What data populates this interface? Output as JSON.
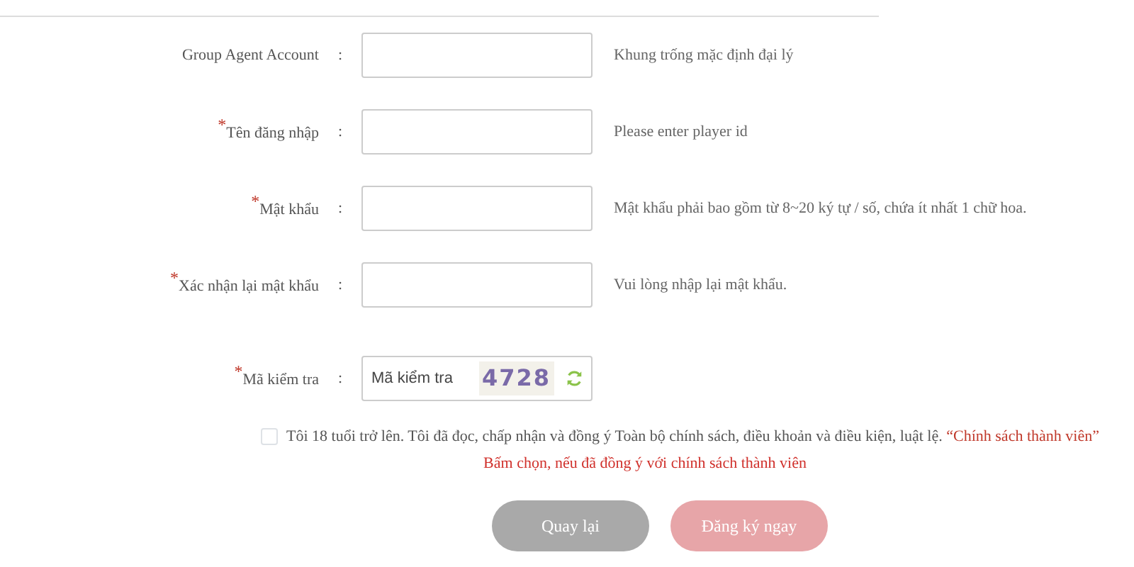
{
  "fields": [
    {
      "label": "Group Agent Account",
      "separator": ":",
      "hint": "Khung trống mặc định đại lý"
    },
    {
      "mark": "*",
      "label": "Tên đăng nhập",
      "separator": ":",
      "hint": "Please enter player id"
    },
    {
      "mark": "*",
      "label": "Mật khẩu",
      "separator": ":",
      "hint": "Mật khẩu phải bao gồm từ 8~20 ký tự / số, chứa ít nhất 1 chữ hoa."
    },
    {
      "mark": "*",
      "label": "Xác nhận lại mật khẩu",
      "separator": ":",
      "hint": "Vui lòng nhập lại mật khẩu."
    }
  ],
  "captcha": {
    "mark": "*",
    "label": "Mã kiểm tra",
    "separator": ":",
    "placeholder": "Mã kiểm tra",
    "code": "4728"
  },
  "agreement": {
    "checked": false,
    "text": "Tôi 18 tuổi trở lên. Tôi đã đọc, chấp nhận và đồng ý Toàn bộ chính sách, điều khoản và điều kiện, luật lệ.",
    "link": "“Chính sách thành viên”",
    "warning": "Bấm chọn, nếu đã đồng ý với chính sách thành viên"
  },
  "buttons": [
    {
      "label": "Quay lại",
      "kind": "back"
    },
    {
      "label": "Đăng ký ngay",
      "kind": "submit"
    }
  ]
}
